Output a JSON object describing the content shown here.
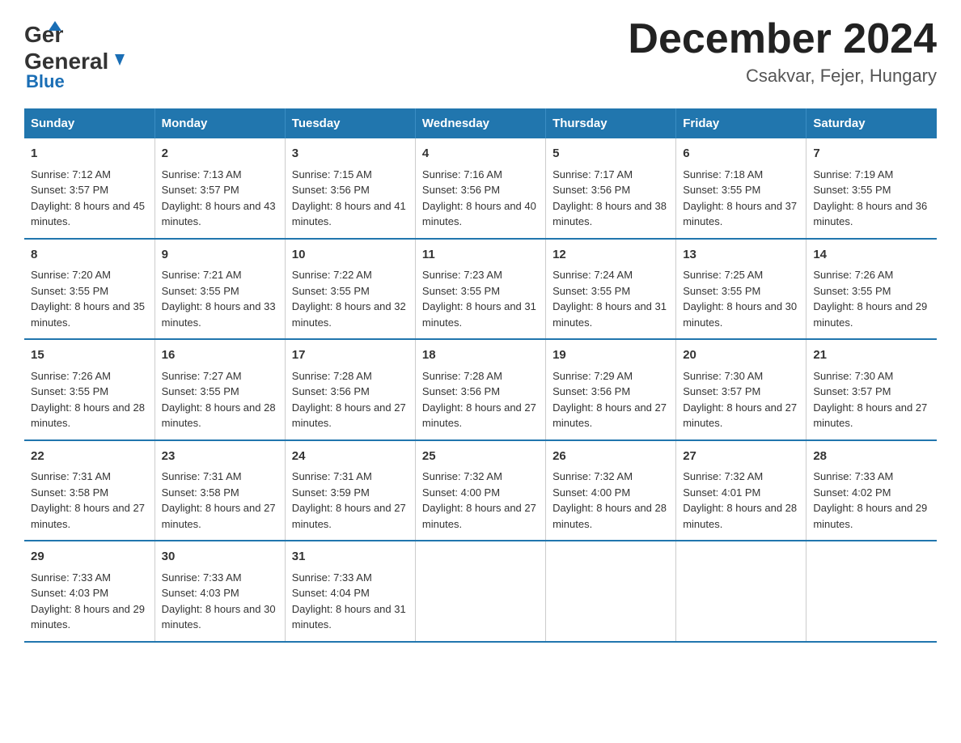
{
  "header": {
    "logo_general": "General",
    "logo_blue": "Blue",
    "month_title": "December 2024",
    "location": "Csakvar, Fejer, Hungary"
  },
  "weekdays": [
    "Sunday",
    "Monday",
    "Tuesday",
    "Wednesday",
    "Thursday",
    "Friday",
    "Saturday"
  ],
  "weeks": [
    [
      {
        "day": "1",
        "sunrise": "7:12 AM",
        "sunset": "3:57 PM",
        "daylight": "8 hours and 45 minutes."
      },
      {
        "day": "2",
        "sunrise": "7:13 AM",
        "sunset": "3:57 PM",
        "daylight": "8 hours and 43 minutes."
      },
      {
        "day": "3",
        "sunrise": "7:15 AM",
        "sunset": "3:56 PM",
        "daylight": "8 hours and 41 minutes."
      },
      {
        "day": "4",
        "sunrise": "7:16 AM",
        "sunset": "3:56 PM",
        "daylight": "8 hours and 40 minutes."
      },
      {
        "day": "5",
        "sunrise": "7:17 AM",
        "sunset": "3:56 PM",
        "daylight": "8 hours and 38 minutes."
      },
      {
        "day": "6",
        "sunrise": "7:18 AM",
        "sunset": "3:55 PM",
        "daylight": "8 hours and 37 minutes."
      },
      {
        "day": "7",
        "sunrise": "7:19 AM",
        "sunset": "3:55 PM",
        "daylight": "8 hours and 36 minutes."
      }
    ],
    [
      {
        "day": "8",
        "sunrise": "7:20 AM",
        "sunset": "3:55 PM",
        "daylight": "8 hours and 35 minutes."
      },
      {
        "day": "9",
        "sunrise": "7:21 AM",
        "sunset": "3:55 PM",
        "daylight": "8 hours and 33 minutes."
      },
      {
        "day": "10",
        "sunrise": "7:22 AM",
        "sunset": "3:55 PM",
        "daylight": "8 hours and 32 minutes."
      },
      {
        "day": "11",
        "sunrise": "7:23 AM",
        "sunset": "3:55 PM",
        "daylight": "8 hours and 31 minutes."
      },
      {
        "day": "12",
        "sunrise": "7:24 AM",
        "sunset": "3:55 PM",
        "daylight": "8 hours and 31 minutes."
      },
      {
        "day": "13",
        "sunrise": "7:25 AM",
        "sunset": "3:55 PM",
        "daylight": "8 hours and 30 minutes."
      },
      {
        "day": "14",
        "sunrise": "7:26 AM",
        "sunset": "3:55 PM",
        "daylight": "8 hours and 29 minutes."
      }
    ],
    [
      {
        "day": "15",
        "sunrise": "7:26 AM",
        "sunset": "3:55 PM",
        "daylight": "8 hours and 28 minutes."
      },
      {
        "day": "16",
        "sunrise": "7:27 AM",
        "sunset": "3:55 PM",
        "daylight": "8 hours and 28 minutes."
      },
      {
        "day": "17",
        "sunrise": "7:28 AM",
        "sunset": "3:56 PM",
        "daylight": "8 hours and 27 minutes."
      },
      {
        "day": "18",
        "sunrise": "7:28 AM",
        "sunset": "3:56 PM",
        "daylight": "8 hours and 27 minutes."
      },
      {
        "day": "19",
        "sunrise": "7:29 AM",
        "sunset": "3:56 PM",
        "daylight": "8 hours and 27 minutes."
      },
      {
        "day": "20",
        "sunrise": "7:30 AM",
        "sunset": "3:57 PM",
        "daylight": "8 hours and 27 minutes."
      },
      {
        "day": "21",
        "sunrise": "7:30 AM",
        "sunset": "3:57 PM",
        "daylight": "8 hours and 27 minutes."
      }
    ],
    [
      {
        "day": "22",
        "sunrise": "7:31 AM",
        "sunset": "3:58 PM",
        "daylight": "8 hours and 27 minutes."
      },
      {
        "day": "23",
        "sunrise": "7:31 AM",
        "sunset": "3:58 PM",
        "daylight": "8 hours and 27 minutes."
      },
      {
        "day": "24",
        "sunrise": "7:31 AM",
        "sunset": "3:59 PM",
        "daylight": "8 hours and 27 minutes."
      },
      {
        "day": "25",
        "sunrise": "7:32 AM",
        "sunset": "4:00 PM",
        "daylight": "8 hours and 27 minutes."
      },
      {
        "day": "26",
        "sunrise": "7:32 AM",
        "sunset": "4:00 PM",
        "daylight": "8 hours and 28 minutes."
      },
      {
        "day": "27",
        "sunrise": "7:32 AM",
        "sunset": "4:01 PM",
        "daylight": "8 hours and 28 minutes."
      },
      {
        "day": "28",
        "sunrise": "7:33 AM",
        "sunset": "4:02 PM",
        "daylight": "8 hours and 29 minutes."
      }
    ],
    [
      {
        "day": "29",
        "sunrise": "7:33 AM",
        "sunset": "4:03 PM",
        "daylight": "8 hours and 29 minutes."
      },
      {
        "day": "30",
        "sunrise": "7:33 AM",
        "sunset": "4:03 PM",
        "daylight": "8 hours and 30 minutes."
      },
      {
        "day": "31",
        "sunrise": "7:33 AM",
        "sunset": "4:04 PM",
        "daylight": "8 hours and 31 minutes."
      },
      null,
      null,
      null,
      null
    ]
  ],
  "labels": {
    "sunrise": "Sunrise:",
    "sunset": "Sunset:",
    "daylight": "Daylight:"
  }
}
